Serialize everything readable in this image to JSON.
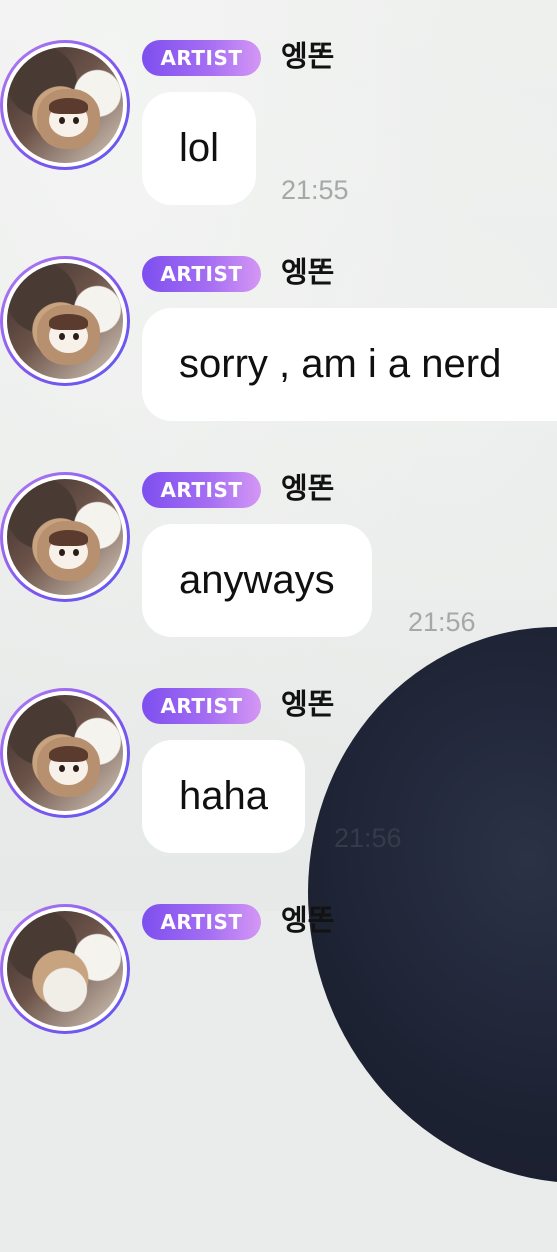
{
  "chat": {
    "messages": [
      {
        "badge": "ARTIST",
        "sender": "엥똔",
        "text": "lol",
        "time": "21:55"
      },
      {
        "badge": "ARTIST",
        "sender": "엥똔",
        "text": "sorry , am i a nerd",
        "time": ""
      },
      {
        "badge": "ARTIST",
        "sender": "엥똔",
        "text": "anyways",
        "time": "21:56"
      },
      {
        "badge": "ARTIST",
        "sender": "엥똔",
        "text": "haha",
        "time": "21:56"
      },
      {
        "badge": "ARTIST",
        "sender": "엥똔",
        "text": "",
        "time": ""
      }
    ]
  },
  "colors": {
    "badge_gradient_start": "#7e4ff0",
    "badge_gradient_end": "#d497f4",
    "bubble": "#ffffff",
    "timestamp": "#a5a8a7"
  }
}
